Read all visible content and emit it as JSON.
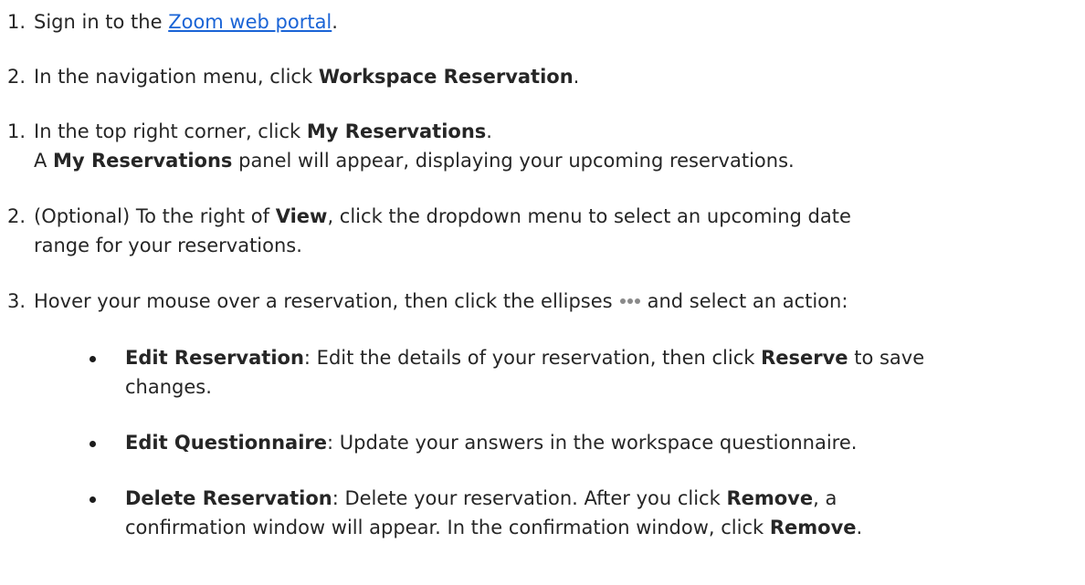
{
  "steps": [
    {
      "number": "1.",
      "pre": "Sign in to the ",
      "link": "Zoom web portal",
      "post": "."
    },
    {
      "number": "2.",
      "pre": "In the navigation menu, click ",
      "bold": "Workspace Reservation",
      "post": "."
    },
    {
      "number": "1.",
      "line1_pre": "In the top right corner, click ",
      "line1_bold": "My Reservations",
      "line1_post": ".",
      "line2_pre": "A ",
      "line2_bold": "My Reservations",
      "line2_post": " panel will appear, displaying your upcoming reservations."
    },
    {
      "number": "2.",
      "line1_pre": "(Optional) To the right of ",
      "line1_bold": "View",
      "line1_post": ", click the dropdown menu to select an upcoming date",
      "line2": "range for your reservations."
    },
    {
      "number": "3.",
      "pre": "Hover your mouse over a reservation, then click the ellipses",
      "icon": "ellipsis-icon",
      "post": "and select an action:"
    }
  ],
  "bullets": [
    {
      "bold": "Edit Reservation",
      "line1": ": Edit the details of your reservation, then click ",
      "line1_bold": "Reserve",
      "line1_post": " to save",
      "line2": "changes."
    },
    {
      "bold": "Edit Questionnaire",
      "line1": ": Update your answers in the workspace questionnaire."
    },
    {
      "bold": "Delete Reservation",
      "line1": ": Delete your reservation. After you click ",
      "line1_bold": "Remove",
      "line1_post": ", a",
      "line2_pre": "confirmation window will appear. In the confirmation window, click ",
      "line2_bold": "Remove",
      "line2_post": "."
    }
  ],
  "colors": {
    "text": "#262626",
    "link": "#1a64d6"
  }
}
